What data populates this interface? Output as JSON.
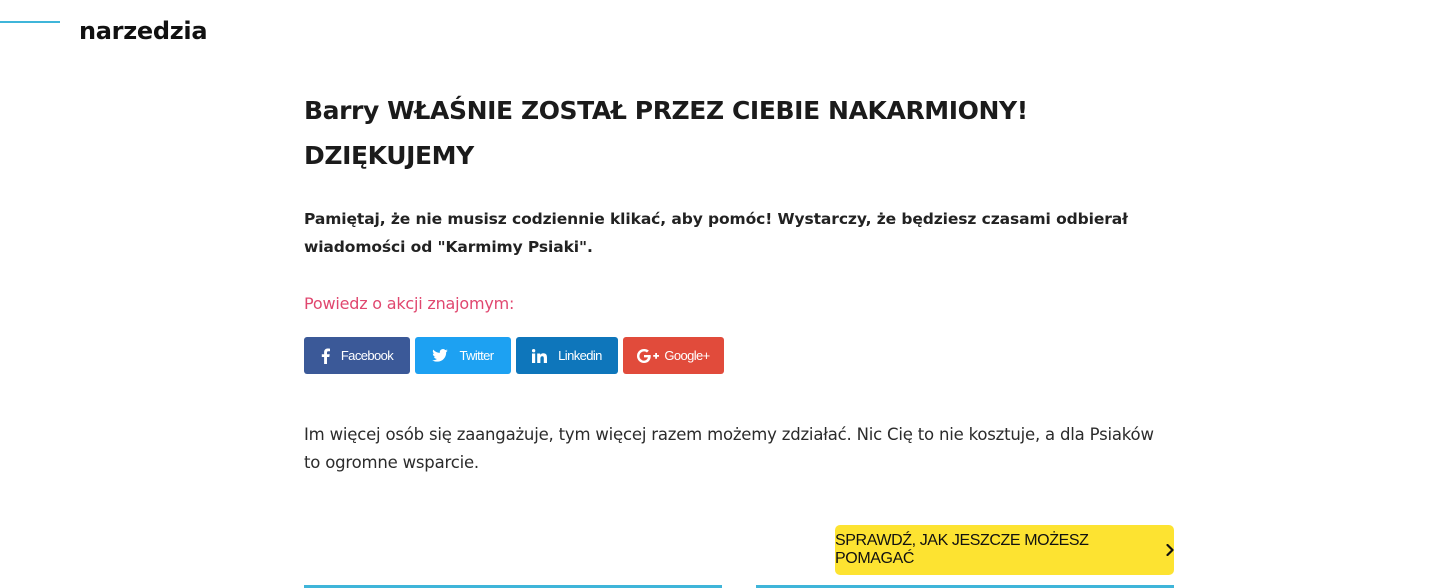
{
  "brand": {
    "text": "narzedzia"
  },
  "headline": {
    "line1": "Barry WŁAŚNIE ZOSTAŁ PRZEZ CIEBIE NAKARMIONY!",
    "line2": "DZIĘKUJEMY"
  },
  "lead": "Pamiętaj, że nie musisz codziennie klikać, aby pomóc! Wystarczy, że będziesz czasami odbierał wiadomości od \"Karmimy Psiaki\".",
  "share": {
    "prompt": "Powiedz o akcji znajomym:",
    "buttons": [
      {
        "label": "Facebook",
        "icon": "facebook-icon",
        "color": "#3b5998"
      },
      {
        "label": "Twitter",
        "icon": "twitter-icon",
        "color": "#1da1f2"
      },
      {
        "label": "Linkedin",
        "icon": "linkedin-icon",
        "color": "#0e76bb"
      },
      {
        "label": "Google+",
        "icon": "google-plus-icon",
        "color": "#e14b3b"
      }
    ]
  },
  "body_text": "Im więcej osób się zaangażuje, tym więcej razem możemy zdziałać. Nic Cię to nie kosztuje, a dla Psiaków to ogromne wsparcie.",
  "cta": {
    "label": "SPRAWDŹ, JAK JESZCZE MOŻESZ POMAGAĆ",
    "icon": "chevron-right-icon",
    "color": "#fde331"
  },
  "colors": {
    "accent": "#3fb5d9",
    "share_prompt": "#e0476f"
  }
}
